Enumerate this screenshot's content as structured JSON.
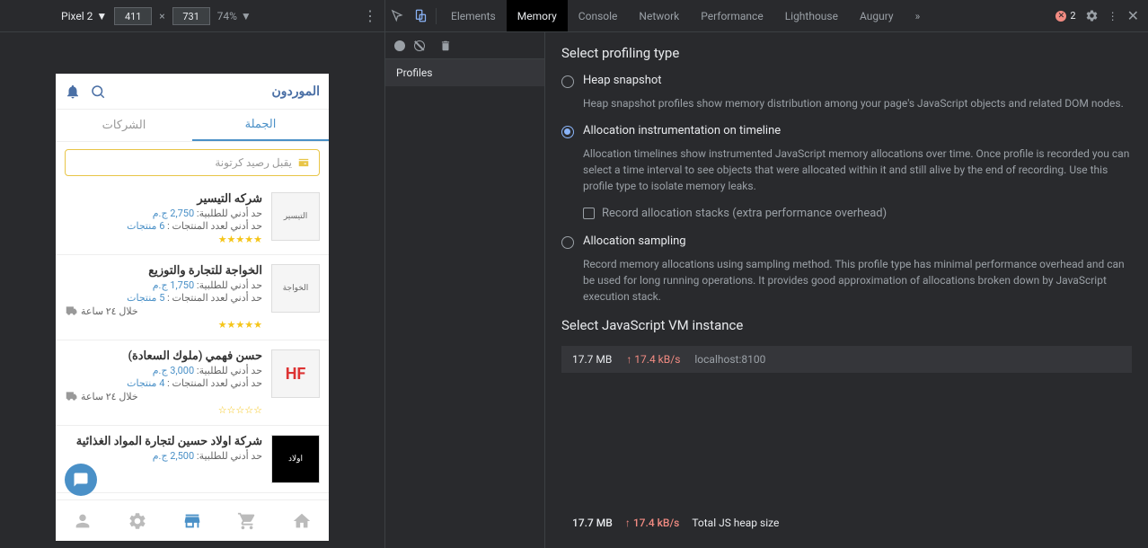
{
  "device_toolbar": {
    "device": "Pixel 2",
    "width": "411",
    "height": "731",
    "zoom": "74%"
  },
  "phone": {
    "title": "الموردون",
    "tabs": {
      "wholesale": "الجملة",
      "companies": "الشركات"
    },
    "search_placeholder": "يقبل رصيد كرتونة",
    "items": [
      {
        "name": "شركه التيسير",
        "min_order_label": "حد أدني للطلبية:",
        "min_order_value": "2,750 ج.م",
        "min_prod_label": "حد أدني لعدد المنتجات :",
        "min_prod_value": "6 منتجات",
        "time": "",
        "logo": "التيسير"
      },
      {
        "name": "الخواجة للتجارة والتوزيع",
        "min_order_label": "حد أدني للطلبية:",
        "min_order_value": "1,750 ج.م",
        "min_prod_label": "حد أدني لعدد المنتجات :",
        "min_prod_value": "5 منتجات",
        "time": "خلال ٢٤ ساعة",
        "logo": "الخواجة"
      },
      {
        "name": "حسن فهمي (ملوك السعادة)",
        "min_order_label": "حد أدني للطلبية:",
        "min_order_value": "3,000 ج.م",
        "min_prod_label": "حد أدني لعدد المنتجات :",
        "min_prod_value": "4 منتجات",
        "time": "خلال ٢٤ ساعة",
        "logo": "HF"
      },
      {
        "name": "شركة اولاد حسين لتجارة المواد الغذائية",
        "min_order_label": "حد أدني للطلبية:",
        "min_order_value": "2,500 ج.م",
        "min_prod_label": "",
        "min_prod_value": "",
        "time": "",
        "logo": "اولاد"
      }
    ]
  },
  "devtools": {
    "tabs": [
      "Elements",
      "Memory",
      "Console",
      "Network",
      "Performance",
      "Lighthouse",
      "Augury"
    ],
    "active_tab": "Memory",
    "errors": "2",
    "profiles_label": "Profiles",
    "select_profiling": "Select profiling type",
    "opts": {
      "heap": {
        "label": "Heap snapshot",
        "desc": "Heap snapshot profiles show memory distribution among your page's JavaScript objects and related DOM nodes."
      },
      "timeline": {
        "label": "Allocation instrumentation on timeline",
        "desc": "Allocation timelines show instrumented JavaScript memory allocations over time. Once profile is recorded you can select a time interval to see objects that were allocated within it and still alive by the end of recording. Use this profile type to isolate memory leaks.",
        "checkbox": "Record allocation stacks (extra performance overhead)"
      },
      "sampling": {
        "label": "Allocation sampling",
        "desc": "Record memory allocations using sampling method. This profile type has minimal performance overhead and can be used for long running operations. It provides good approximation of allocations broken down by JavaScript execution stack."
      }
    },
    "vm_title": "Select JavaScript VM instance",
    "vm": {
      "size": "17.7 MB",
      "rate": "↑ 17.4 kB/s",
      "host": "localhost:8100"
    },
    "footer": {
      "size": "17.7 MB",
      "rate": "↑ 17.4 kB/s",
      "label": "Total JS heap size"
    }
  }
}
